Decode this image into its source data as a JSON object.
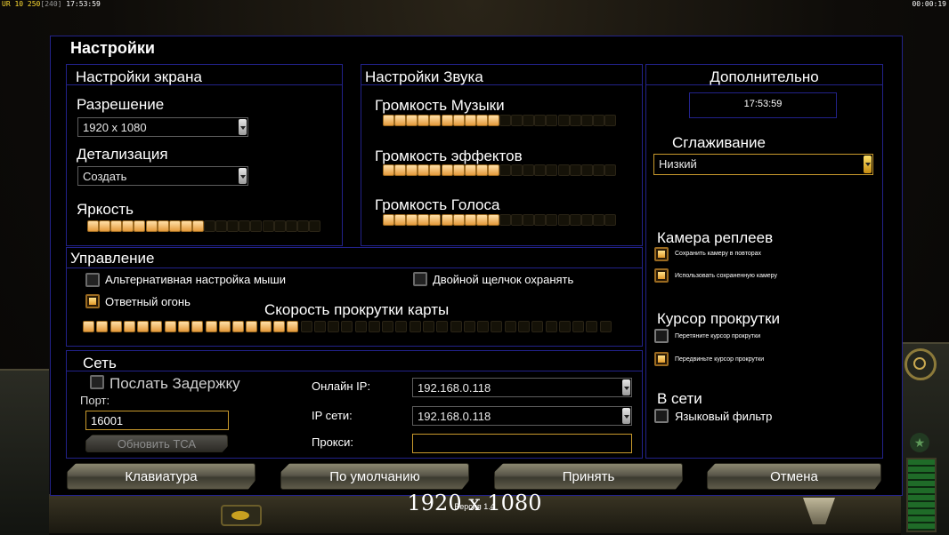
{
  "hud": {
    "left_prefix": "UR",
    "left_money": "10 250",
    "left_power": "[240]",
    "left_time": "17:53:59",
    "right_time": "00:00:19"
  },
  "dialog": {
    "title": "Настройки"
  },
  "screen": {
    "title": "Настройки экрана",
    "resolution_label": "Разрешение",
    "resolution_value": "1920 x 1080",
    "detail_label": "Детализация",
    "detail_value": "Создать",
    "brightness_label": "Яркость",
    "brightness_level": 0.5
  },
  "sound": {
    "title": "Настройки Звука",
    "music_label": "Громкость Музыки",
    "music_level": 0.5,
    "effects_label": "Громкость эффектов",
    "effects_level": 0.5,
    "voice_label": "Громкость Голоса",
    "voice_level": 0.5
  },
  "extra": {
    "title": "Дополнительно",
    "clock": "17:53:59",
    "aa_label": "Сглаживание",
    "aa_value": "Низкий",
    "replay_title": "Камера реплеев",
    "replay_opt1": "Сохранить камеру в повторах",
    "replay_opt2": "Использовать сохраненную камеру",
    "cursor_title": "Курсор прокрутки",
    "cursor_opt1": "Перетяните курсор прокрутки",
    "cursor_opt2": "Передвиньте курсор прокрутки",
    "online_title": "В сети",
    "lang_filter": "Языковый фильтр"
  },
  "control": {
    "title": "Управление",
    "alt_mouse": "Альтернативная настройка мыши",
    "double_click": "Двойной щелчок охранять",
    "return_fire": "Ответный огонь",
    "scroll_label": "Скорость прокрутки карты",
    "scroll_level": 0.4
  },
  "network": {
    "title": "Сеть",
    "send_delay": "Послать Задержку",
    "port_label": "Порт:",
    "port_value": "16001",
    "update_btn": "Обновить ТСА",
    "online_ip_label": "Онлайн IP:",
    "online_ip_value": "192.168.0.118",
    "lan_ip_label": "IP сети:",
    "lan_ip_value": "192.168.0.118",
    "proxy_label": "Прокси:",
    "proxy_value": ""
  },
  "buttons": {
    "keyboard": "Клавиатура",
    "defaults": "По умолчанию",
    "accept": "Принять",
    "cancel": "Отмена"
  },
  "footer": {
    "resolution_caption": "1920 x 1080",
    "version_caption": "Версия 1.4"
  }
}
